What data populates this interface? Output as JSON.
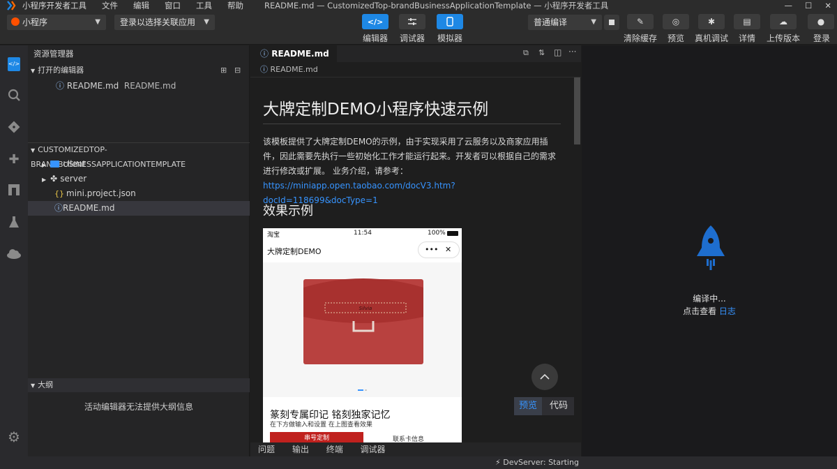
{
  "titlebar": {
    "menu": [
      "小程序开发者工具",
      "文件",
      "编辑",
      "窗口",
      "工具",
      "帮助"
    ],
    "window_title": "README.md — CustomizedTop-brandBusinessApplicationTemplate — 小程序开发者工具"
  },
  "toolbar": {
    "project_type": "小程序",
    "login_select": "登录以选择关联应用",
    "views": [
      {
        "label": "编辑器",
        "icon": "code-icon"
      },
      {
        "label": "调试器",
        "icon": "sliders-icon"
      },
      {
        "label": "模拟器",
        "icon": "phone-icon"
      }
    ],
    "compile_mode": "普通编译",
    "actions": [
      {
        "label": "清除缓存",
        "icon": "broom-icon"
      },
      {
        "label": "预览",
        "icon": "preview-icon"
      },
      {
        "label": "真机调试",
        "icon": "bug-icon"
      },
      {
        "label": "详情",
        "icon": "document-icon"
      },
      {
        "label": "上传版本",
        "icon": "cloud-upload-icon"
      },
      {
        "label": "登录",
        "icon": "user-icon"
      }
    ]
  },
  "sidebar": {
    "title": "资源管理器",
    "open_editors": {
      "heading": "打开的编辑器",
      "items": [
        {
          "name": "README.md",
          "path": "README.md"
        }
      ]
    },
    "project": {
      "heading": "CUSTOMIZEDTOP-BRANDBUSINESSAPPLICATIONTEMPLATE",
      "items": [
        {
          "name": "client",
          "kind": "folder"
        },
        {
          "name": "server",
          "kind": "folder"
        },
        {
          "name": "mini.project.json",
          "kind": "json"
        },
        {
          "name": "README.md",
          "kind": "md"
        }
      ]
    },
    "outline": {
      "heading": "大纲",
      "empty_text": "活动编辑器无法提供大纲信息"
    }
  },
  "editor": {
    "tab": "README.md",
    "breadcrumb": "README.md",
    "h1": "大牌定制DEMO小程序快速示例",
    "paragraph": "该模板提供了大牌定制DEMO的示例，由于实现采用了云服务以及商家应用插件，因此需要先执行一些初始化工作才能运行起来。开发者可以根据自己的需求进行修改或扩展。 业务介绍，请参考：",
    "link": "https://miniapp.open.taobao.com/docV3.htm?docId=118699&docType=1",
    "h2": "效果示例",
    "phone": {
      "carrier": "淘宝",
      "time": "11:54",
      "battery": "100%",
      "nav_title": "大牌定制DEMO",
      "product_name": "Silvia",
      "headline": "篆刻专属印记 铭刻独家记忆",
      "subline": "在下方做输入和设置 在上图查看效果",
      "bottom_left": "串号定制",
      "bottom_right": "联系卡信息"
    },
    "float": {
      "preview": "预览",
      "code": "代码"
    },
    "panel_tabs": [
      "问题",
      "输出",
      "终端",
      "调试器"
    ]
  },
  "simulator": {
    "status": "编译中...",
    "hint": "点击查看",
    "link": "日志",
    "accent": "#1e6ecf"
  },
  "statusbar": {
    "devserver": "DevServer: Starting"
  }
}
